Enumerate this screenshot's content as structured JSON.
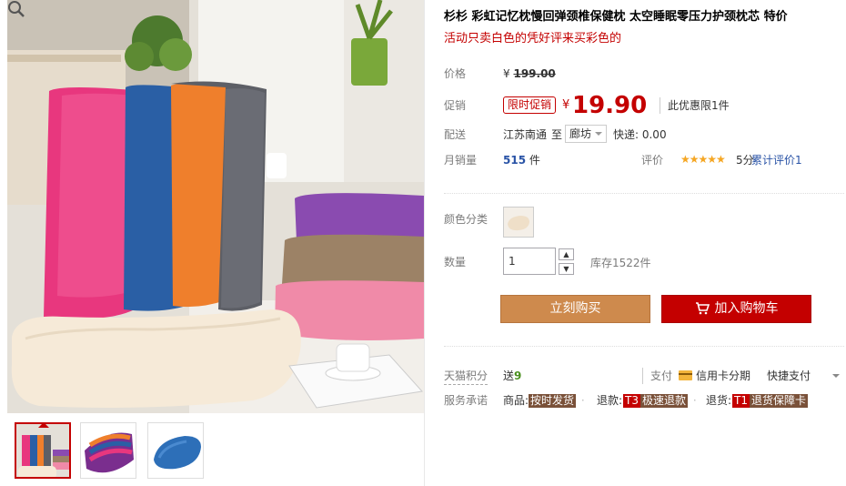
{
  "product": {
    "title": "杉杉 彩虹记忆枕慢回弹颈椎保健枕 太空睡眠零压力护颈枕芯 特价",
    "subtitle": "活动只卖白色的凭好评来买彩色的"
  },
  "price": {
    "label": "价格",
    "currency": "¥",
    "original": "199.00"
  },
  "promotion": {
    "label": "促销",
    "badge": "限时促销",
    "currency": "¥",
    "sale_price": "19.90",
    "limit_note": "此优惠限1件"
  },
  "shipping": {
    "label": "配送",
    "from": "江苏南通",
    "to_label": "至",
    "to_city": "廊坊",
    "fee": "快递: 0.00"
  },
  "sales": {
    "label": "月销量",
    "count": "515",
    "unit": "件",
    "rating_label": "评价",
    "stars": "★★★★★",
    "score": "5分",
    "review_count": "累计评价1"
  },
  "options": {
    "color_label": "颜色分类",
    "quantity_label": "数量",
    "quantity_value": "1",
    "stock": "库存1522件",
    "qty_up_icon": "▲",
    "qty_down_icon": "▼"
  },
  "actions": {
    "buy_now": "立刻购买",
    "add_to_cart": "加入购物车"
  },
  "points": {
    "label": "天猫积分",
    "prefix": "送",
    "value": "9"
  },
  "payment": {
    "label": "支付",
    "card": "信用卡分期",
    "fast": "快捷支付"
  },
  "services": {
    "label": "服务承诺",
    "goods_prefix": "商品:",
    "goods_tag": "按时发货",
    "refund_prefix": "退款:",
    "refund_t": "T3",
    "refund_tag": "极速退款",
    "return_prefix": "退货:",
    "return_t": "T1",
    "return_tag": "退货保障卡",
    "separator": "·"
  },
  "colors": {
    "accent_red": "#c40000",
    "buy_button": "#ce8a4d",
    "link_blue": "#2953a6",
    "star": "#f5a623"
  }
}
